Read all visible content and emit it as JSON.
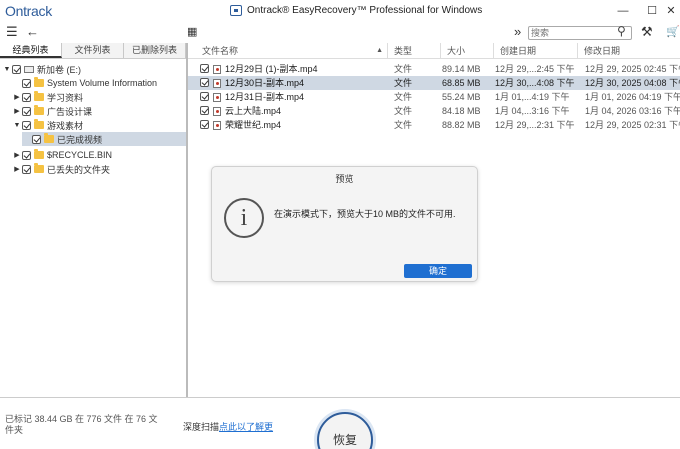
{
  "titlebar": {
    "brand": "Ontrack",
    "title": "Ontrack® EasyRecovery™ Professional for Windows",
    "minimize": "—",
    "maximize": "☐",
    "close": "✕"
  },
  "toolbar": {
    "menu_icon": "☰",
    "back_icon": "←",
    "view_icon": "▦",
    "expand_icon": "»",
    "search_placeholder": "搜索",
    "search_icon": "⚲",
    "wrench_icon": "⚒",
    "cart_icon": "🛒"
  },
  "tabs": [
    "经典列表",
    "文件列表",
    "已删除列表"
  ],
  "tree": [
    {
      "label": "新加卷 (E:)",
      "arrow": "▼",
      "icon": "drive"
    },
    {
      "label": "System Volume Information",
      "arrow": "",
      "icon": "folder"
    },
    {
      "label": "学习资料",
      "arrow": "▶",
      "icon": "folder"
    },
    {
      "label": "广告设计课",
      "arrow": "▶",
      "icon": "folder"
    },
    {
      "label": "游戏素材",
      "arrow": "▼",
      "icon": "folder"
    },
    {
      "label": "已完成视频",
      "arrow": "",
      "icon": "folder"
    },
    {
      "label": "$RECYCLE.BIN",
      "arrow": "▶",
      "icon": "folder"
    },
    {
      "label": "已丢失的文件夹",
      "arrow": "▶",
      "icon": "folder"
    }
  ],
  "columns": {
    "name": "文件名称",
    "sort_icon": "▲",
    "type": "类型",
    "size": "大小",
    "created": "创建日期",
    "modified": "修改日期"
  },
  "files": [
    {
      "name": "12月29日 (1)-副本.mp4",
      "type": "文件",
      "size": "89.14 MB",
      "created": "12月 29,...2:45 下午",
      "modified": "12月 29, 2025 02:45 下午"
    },
    {
      "name": "12月30日-副本.mp4",
      "type": "文件",
      "size": "68.85 MB",
      "created": "12月 30,...4:08 下午",
      "modified": "12月 30, 2025 04:08 下午"
    },
    {
      "name": "12月31日-副本.mp4",
      "type": "文件",
      "size": "55.24 MB",
      "created": "1月 01,...4:19 下午",
      "modified": "1月 01, 2026 04:19 下午"
    },
    {
      "name": "云上大陆.mp4",
      "type": "文件",
      "size": "84.18 MB",
      "created": "1月 04,...3:16 下午",
      "modified": "1月 04, 2026 03:16 下午"
    },
    {
      "name": "荣耀世纪.mp4",
      "type": "文件",
      "size": "88.82 MB",
      "created": "12月 29,...2:31 下午",
      "modified": "12月 29, 2025 02:31 下午"
    }
  ],
  "dialog": {
    "title": "预览",
    "info_icon": "i",
    "message": "在演示模式下，预览大于10 MB的文件不可用.",
    "ok": "确定"
  },
  "footer": {
    "status": "已标记 38.44 GB 在 776 文件 在 76 文件夹",
    "deep_scan_label": "深度扫描",
    "deep_scan_link": "点此以了解更",
    "recover": "恢复"
  }
}
